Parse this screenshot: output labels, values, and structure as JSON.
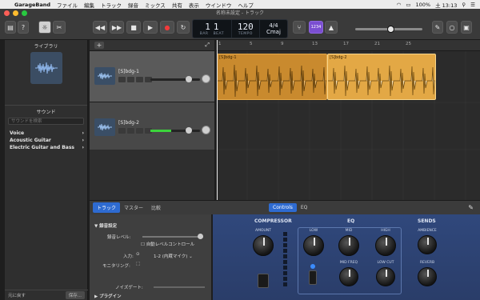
{
  "menubar": {
    "app": "GarageBand",
    "items": [
      "ファイル",
      "編集",
      "トラック",
      "録音",
      "ミックス",
      "共有",
      "表示",
      "ウインドウ",
      "ヘルプ"
    ],
    "battery": "100%",
    "clock": "土 13:13"
  },
  "window": {
    "title": "名称未設定 - トラック"
  },
  "lcd": {
    "bar": "1",
    "beat": "1",
    "bar_label": "BAR",
    "beat_label": "BEAT",
    "tempo": "120",
    "tempo_label": "TEMPO",
    "signature": "4/4",
    "key": "Cmaj"
  },
  "toolbar": {
    "count_in": "1234"
  },
  "library": {
    "title": "ライブラリ",
    "sound_title": "サウンド",
    "search_placeholder": "サウンドを検索",
    "items": [
      "Voice",
      "Acoustic Guitar",
      "Electric Guitar and Bass"
    ],
    "revert": "元に戻す",
    "save": "保存..."
  },
  "tracks": [
    {
      "name": "[S]bdg-1"
    },
    {
      "name": "[S]bdg-2"
    }
  ],
  "ruler": {
    "marks": [
      "1",
      "5",
      "9",
      "13",
      "17",
      "21",
      "25"
    ]
  },
  "regions": [
    {
      "label": "[S]bdg-1"
    },
    {
      "label": "[S]bdg-2"
    }
  ],
  "smart_controls": {
    "tabs": [
      "トラック",
      "マスター",
      "比較"
    ],
    "view_tabs": [
      "Controls",
      "EQ"
    ],
    "recording_settings": "録音設定",
    "rec_level": "録音レベル:",
    "auto_level": "自動レベルコントロール",
    "input_label": "入力:",
    "input_value": "1-2 (内蔵マイク)",
    "monitoring": "モニタリング:",
    "noise_gate": "ノイズゲート:",
    "plugins": "プラグイン"
  },
  "plugin": {
    "sections": [
      "COMPRESSOR",
      "EQ",
      "SENDS"
    ],
    "knobs": {
      "amount": "AMOUNT",
      "low": "LOW",
      "mid": "MID",
      "high": "HIGH",
      "mid_freq": "MID FREQ",
      "low_cut": "LOW CUT",
      "ambience": "AMBIENCE",
      "reverb": "REVERB"
    }
  }
}
